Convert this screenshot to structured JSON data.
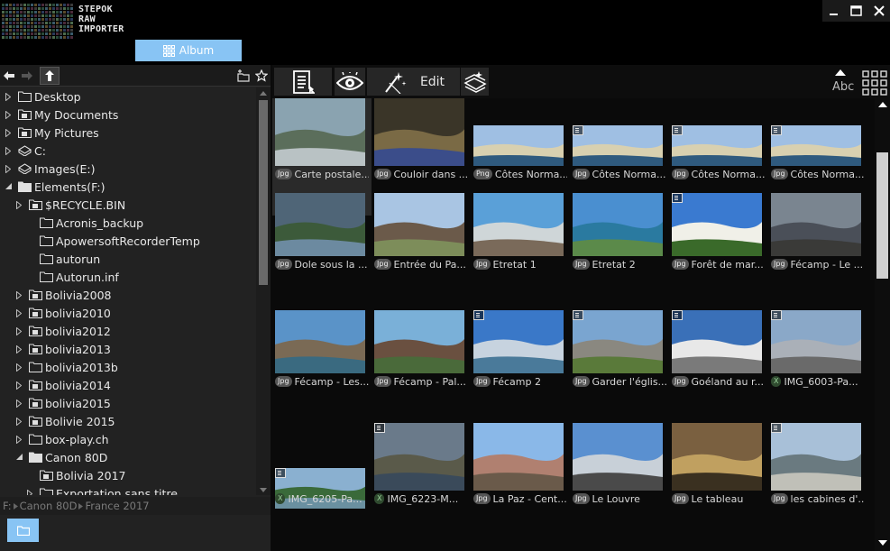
{
  "app": {
    "logo_icon": "raw-letters-logo",
    "title_lines": [
      "STEPOK",
      "RAW",
      "IMPORTER"
    ],
    "window_controls": [
      "minimize-icon",
      "maximize-icon",
      "close-icon"
    ]
  },
  "tabs": {
    "album_label": "Album"
  },
  "tree": {
    "nav_icons": [
      "arrow-left-icon",
      "arrow-right-icon",
      "arrow-up-icon",
      "new-folder-icon",
      "star-icon"
    ],
    "items": [
      {
        "label": "Desktop",
        "icon": "folder"
      },
      {
        "label": "My Documents",
        "icon": "documents-folder"
      },
      {
        "label": "My Pictures",
        "icon": "documents-folder"
      },
      {
        "label": "C:",
        "icon": "drive"
      },
      {
        "label": "Images(E:)",
        "icon": "drive"
      },
      {
        "label": "Elements(F:)",
        "icon": "folder-open"
      },
      {
        "label": "$RECYCLE.BIN",
        "icon": "documents-folder"
      },
      {
        "label": "Acronis_backup",
        "icon": "folder"
      },
      {
        "label": "ApowersoftRecorderTemp",
        "icon": "folder"
      },
      {
        "label": "autorun",
        "icon": "folder"
      },
      {
        "label": "Autorun.inf",
        "icon": "folder"
      },
      {
        "label": "Bolivia2008",
        "icon": "documents-folder"
      },
      {
        "label": "bolivia2010",
        "icon": "documents-folder"
      },
      {
        "label": "bolivia2012",
        "icon": "documents-folder"
      },
      {
        "label": "bolivia2013",
        "icon": "documents-folder"
      },
      {
        "label": "bolivia2013b",
        "icon": "folder"
      },
      {
        "label": "bolivia2014",
        "icon": "documents-folder"
      },
      {
        "label": "bolivia2015",
        "icon": "documents-folder"
      },
      {
        "label": "Bolivie 2015",
        "icon": "documents-folder"
      },
      {
        "label": "box-play.ch",
        "icon": "folder"
      },
      {
        "label": "Canon 80D",
        "icon": "folder-open"
      },
      {
        "label": "Bolivia 2017",
        "icon": "documents-folder"
      },
      {
        "label": "Exportation sans titre",
        "icon": "folder"
      }
    ],
    "path": [
      "F:",
      "Canon 80D",
      "France 2017"
    ]
  },
  "toolbar": {
    "list_icon": "list-icon",
    "view_icon": "eye-icon",
    "edit_label": "Edit",
    "edit_icon": "magic-wand-icon",
    "batch_icon": "batch-edit-icon",
    "sort_label": "Abc",
    "grid_icon": "grid-view-icon"
  },
  "grid": {
    "items": [
      {
        "label": "Carte postale...",
        "badge": "Jpg",
        "exif": false
      },
      {
        "label": "Couloir dans ...",
        "badge": "Jpg",
        "exif": false
      },
      {
        "label": "Côtes Norma...",
        "badge": "Png",
        "exif": false
      },
      {
        "label": "Côtes Norma...",
        "badge": "Jpg",
        "exif": true
      },
      {
        "label": "Côtes Norma...",
        "badge": "Jpg",
        "exif": true
      },
      {
        "label": "Côtes Norma...",
        "badge": "Jpg",
        "exif": true
      },
      {
        "label": "Dole sous la ...",
        "badge": "Jpg",
        "exif": false
      },
      {
        "label": "Entrée du Pa...",
        "badge": "Jpg",
        "exif": false
      },
      {
        "label": "Etretat 1",
        "badge": "Jpg",
        "exif": false
      },
      {
        "label": "Etretat 2",
        "badge": "Jpg",
        "exif": false
      },
      {
        "label": "Forêt de mar...",
        "badge": "Jpg",
        "exif": true
      },
      {
        "label": "Fécamp - Le ...",
        "badge": "Jpg",
        "exif": false
      },
      {
        "label": "Fécamp - Les...",
        "badge": "Jpg",
        "exif": false
      },
      {
        "label": "Fécamp - Pal...",
        "badge": "Jpg",
        "exif": false
      },
      {
        "label": "Fécamp 2",
        "badge": "Jpg",
        "exif": true
      },
      {
        "label": "Garder l'églis...",
        "badge": "Jpg",
        "exif": true
      },
      {
        "label": "Goéland au r...",
        "badge": "Jpg",
        "exif": true
      },
      {
        "label": "IMG_6003-Pa...",
        "badge": "X",
        "exif": true
      },
      {
        "label": "IMG_6205-Pa...",
        "badge": "X",
        "exif": true
      },
      {
        "label": "IMG_6223-M...",
        "badge": "X",
        "exif": true
      },
      {
        "label": "La Paz - Cent...",
        "badge": "Jpg",
        "exif": false
      },
      {
        "label": "Le Louvre",
        "badge": "Jpg",
        "exif": false
      },
      {
        "label": "Le tableau",
        "badge": "Jpg",
        "exif": false
      },
      {
        "label": "les cabines d'...",
        "badge": "Jpg",
        "exif": true
      }
    ]
  }
}
